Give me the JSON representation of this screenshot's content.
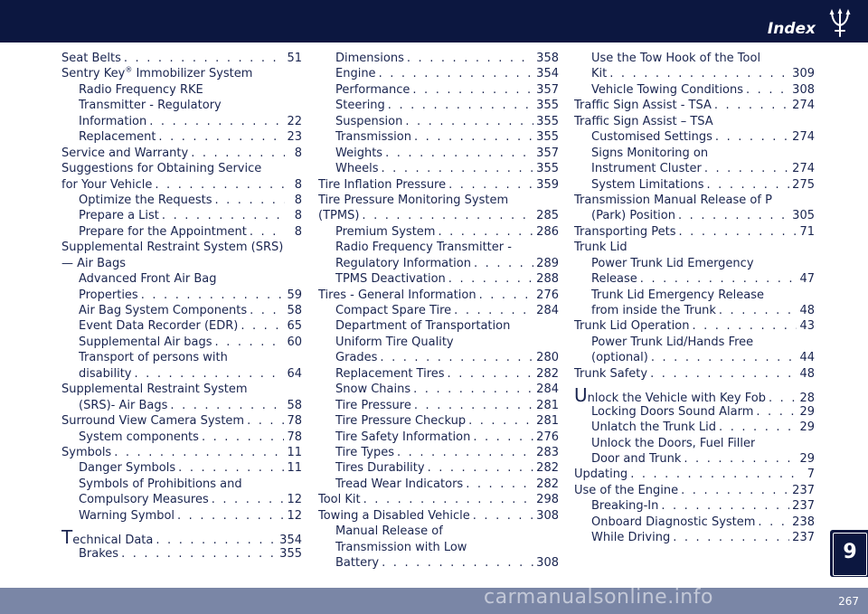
{
  "header": {
    "title": "Index"
  },
  "footer": {
    "page_number": "267",
    "watermark": "carmanualsonline.info"
  },
  "chapter_tab": {
    "number": "9"
  },
  "colors": {
    "navy": "#0c1740",
    "text": "#1a2550",
    "footer": "#7a86a6"
  },
  "icons": {
    "logo": "trident-logo-icon"
  },
  "columns": [
    [
      {
        "text": "Seat Belts",
        "page": "51",
        "level": 0
      },
      {
        "text": "Sentry Key",
        "sup": "®",
        "after": " Immobilizer System",
        "page": "",
        "level": 0
      },
      {
        "text": "Radio Frequency RKE",
        "page": "",
        "level": 1
      },
      {
        "text": "Transmitter - Regulatory",
        "page": "",
        "level": 1
      },
      {
        "text": "Information",
        "page": "22",
        "level": 1
      },
      {
        "text": "Replacement",
        "page": "23",
        "level": 1
      },
      {
        "text": "Service and Warranty",
        "page": "8",
        "level": 0
      },
      {
        "text": "Suggestions  for  Obtaining  Service",
        "page": "",
        "level": 0
      },
      {
        "text": "for Your Vehicle",
        "page": "8",
        "level": 0
      },
      {
        "text": "Optimize the Requests",
        "page": "8",
        "level": 1
      },
      {
        "text": "Prepare a List",
        "page": "8",
        "level": 1
      },
      {
        "text": "Prepare for the Appointment",
        "page": "8",
        "level": 1
      },
      {
        "text": "Supplemental Restraint System (SRS)",
        "page": "",
        "level": 0
      },
      {
        "text": "— Air Bags",
        "page": "",
        "level": 0
      },
      {
        "text": "Advanced Front Air Bag",
        "page": "",
        "level": 1
      },
      {
        "text": "Properties",
        "page": "59",
        "level": 1
      },
      {
        "text": "Air Bag System Components",
        "page": "58",
        "level": 1
      },
      {
        "text": "Event Data Recorder (EDR)",
        "page": "65",
        "level": 1
      },
      {
        "text": "Supplemental Air bags",
        "page": "60",
        "level": 1
      },
      {
        "text": "Transport of persons with",
        "page": "",
        "level": 1
      },
      {
        "text": "disability",
        "page": "64",
        "level": 1
      },
      {
        "text": "Supplemental Restraint System",
        "page": "",
        "level": 0
      },
      {
        "text": "(SRS)- Air Bags",
        "page": "58",
        "level": 1
      },
      {
        "text": "Surround View Camera System",
        "page": "78",
        "level": 0
      },
      {
        "text": "System components",
        "page": "78",
        "level": 1
      },
      {
        "text": "Symbols",
        "page": "11",
        "level": 0
      },
      {
        "text": "Danger Symbols",
        "page": "11",
        "level": 1
      },
      {
        "text": "Symbols of Prohibitions and",
        "page": "",
        "level": 1
      },
      {
        "text": "Compulsory Measures",
        "page": "12",
        "level": 1
      },
      {
        "text": "Warning Symbol",
        "page": "12",
        "level": 1
      },
      {
        "text": "echnical Data",
        "first": "T",
        "page": "354",
        "level": 0,
        "gap": true
      },
      {
        "text": "Brakes",
        "page": "355",
        "level": 1
      }
    ],
    [
      {
        "text": "Dimensions",
        "page": "358",
        "level": 1
      },
      {
        "text": "Engine",
        "page": "354",
        "level": 1
      },
      {
        "text": "Performance",
        "page": "357",
        "level": 1
      },
      {
        "text": "Steering",
        "page": "355",
        "level": 1
      },
      {
        "text": "Suspension",
        "page": "355",
        "level": 1
      },
      {
        "text": "Transmission",
        "page": "355",
        "level": 1
      },
      {
        "text": "Weights",
        "page": "357",
        "level": 1
      },
      {
        "text": "Wheels",
        "page": "355",
        "level": 1
      },
      {
        "text": "Tire Inflation Pressure",
        "page": "359",
        "level": 0
      },
      {
        "text": "Tire Pressure Monitoring System",
        "page": "",
        "level": 0
      },
      {
        "text": "(TPMS)",
        "page": "285",
        "level": 0
      },
      {
        "text": "Premium System",
        "page": "286",
        "level": 1
      },
      {
        "text": "Radio Frequency Transmitter -",
        "page": "",
        "level": 1
      },
      {
        "text": "Regulatory Information",
        "page": "289",
        "level": 1
      },
      {
        "text": "TPMS Deactivation",
        "page": "288",
        "level": 1
      },
      {
        "text": "Tires - General Information",
        "page": "276",
        "level": 0
      },
      {
        "text": "Compact Spare Tire",
        "page": "284",
        "level": 1
      },
      {
        "text": "Department of Transportation",
        "page": "",
        "level": 1
      },
      {
        "text": "Uniform Tire Quality",
        "page": "",
        "level": 1
      },
      {
        "text": "Grades",
        "page": "280",
        "level": 1
      },
      {
        "text": "Replacement Tires",
        "page": "282",
        "level": 1
      },
      {
        "text": "Snow Chains",
        "page": "284",
        "level": 1
      },
      {
        "text": "Tire Pressure",
        "page": "281",
        "level": 1
      },
      {
        "text": "Tire Pressure Checkup",
        "page": "281",
        "level": 1
      },
      {
        "text": "Tire Safety Information",
        "page": "276",
        "level": 1
      },
      {
        "text": "Tire Types",
        "page": "283",
        "level": 1
      },
      {
        "text": "Tires Durability",
        "page": "282",
        "level": 1
      },
      {
        "text": "Tread Wear Indicators",
        "page": "282",
        "level": 1
      },
      {
        "text": "Tool Kit",
        "page": "298",
        "level": 0
      },
      {
        "text": "Towing a Disabled Vehicle",
        "page": "308",
        "level": 0
      },
      {
        "text": "Manual Release of",
        "page": "",
        "level": 1
      },
      {
        "text": "Transmission with Low",
        "page": "",
        "level": 1
      },
      {
        "text": "Battery",
        "page": "308",
        "level": 1
      }
    ],
    [
      {
        "text": "Use the Tow Hook of the Tool",
        "page": "",
        "level": 1
      },
      {
        "text": "Kit",
        "page": "309",
        "level": 1
      },
      {
        "text": "Vehicle Towing Conditions",
        "page": "308",
        "level": 1
      },
      {
        "text": "Traffic Sign Assist - TSA",
        "page": "274",
        "level": 0
      },
      {
        "text": "Traffic Sign Assist – TSA",
        "page": "",
        "level": 0
      },
      {
        "text": "Customised Settings",
        "page": "274",
        "level": 1
      },
      {
        "text": "Signs Monitoring on",
        "page": "",
        "level": 1
      },
      {
        "text": "Instrument Cluster",
        "page": "274",
        "level": 1
      },
      {
        "text": "System Limitations",
        "page": "275",
        "level": 1
      },
      {
        "text": "Transmission Manual Release of P",
        "page": "",
        "level": 0
      },
      {
        "text": "(Park) Position",
        "page": "305",
        "level": 1
      },
      {
        "text": "Transporting Pets",
        "page": "71",
        "level": 0
      },
      {
        "text": "Trunk Lid",
        "page": "",
        "level": 0
      },
      {
        "text": "Power Trunk Lid Emergency",
        "page": "",
        "level": 1
      },
      {
        "text": "Release",
        "page": "47",
        "level": 1
      },
      {
        "text": "Trunk Lid Emergency Release",
        "page": "",
        "level": 1
      },
      {
        "text": "from inside the Trunk",
        "page": "48",
        "level": 1
      },
      {
        "text": "Trunk Lid Operation",
        "page": "43",
        "level": 0
      },
      {
        "text": "Power Trunk Lid/Hands Free",
        "page": "",
        "level": 1
      },
      {
        "text": "(optional)",
        "page": "44",
        "level": 1
      },
      {
        "text": "Trunk Safety",
        "page": "48",
        "level": 0
      },
      {
        "text": "nlock the Vehicle with Key Fob",
        "first": "U",
        "page": "28",
        "level": 0,
        "gap": true
      },
      {
        "text": "Locking Doors Sound Alarm",
        "page": "29",
        "level": 1
      },
      {
        "text": "Unlatch the Trunk Lid",
        "page": "29",
        "level": 1
      },
      {
        "text": "Unlock the Doors, Fuel Filler",
        "page": "",
        "level": 1
      },
      {
        "text": "Door and Trunk",
        "page": "29",
        "level": 1
      },
      {
        "text": "Updating",
        "page": "7",
        "level": 0
      },
      {
        "text": "Use of the Engine",
        "page": "237",
        "level": 0
      },
      {
        "text": "Breaking-In",
        "page": "237",
        "level": 1
      },
      {
        "text": "Onboard Diagnostic System",
        "page": "238",
        "level": 1
      },
      {
        "text": "While Driving",
        "page": "237",
        "level": 1
      }
    ]
  ]
}
